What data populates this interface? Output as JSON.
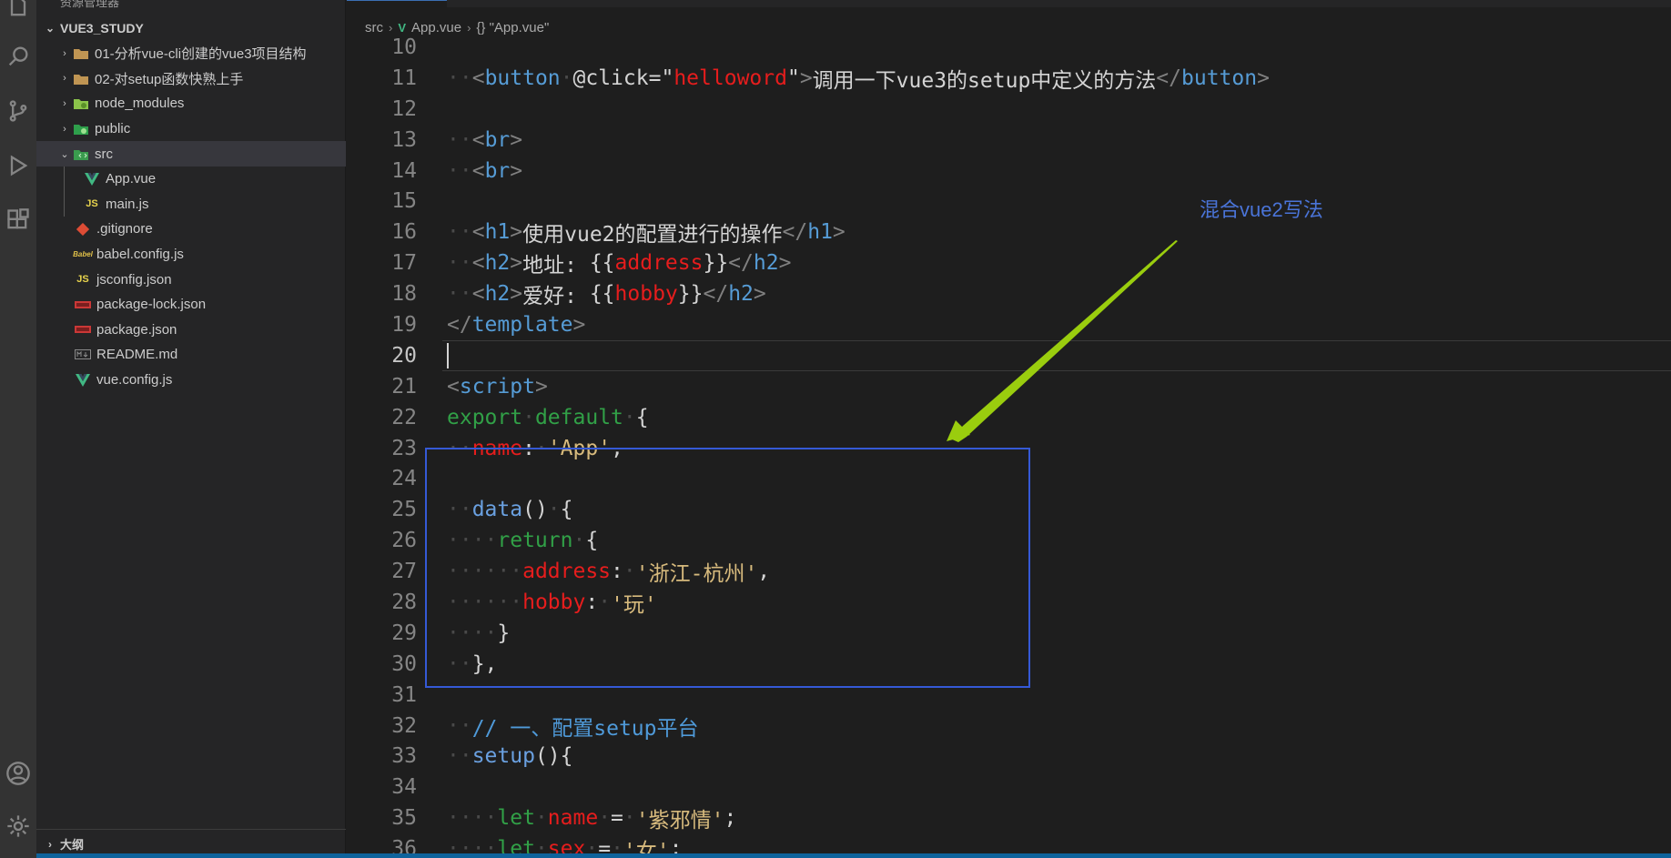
{
  "window": {
    "tab_label": "App.vue"
  },
  "sidebar": {
    "top_cut_label": "资源管理器",
    "root": "VUE3_STUDY",
    "items": [
      {
        "label": "01-分析vue-cli创建的vue3项目结构",
        "type": "folder",
        "expanded": false,
        "icon": "folder-icon"
      },
      {
        "label": "02-对setup函数快熟上手",
        "type": "folder",
        "expanded": false,
        "icon": "folder-icon"
      },
      {
        "label": "node_modules",
        "type": "folder",
        "expanded": false,
        "icon": "node-folder-icon"
      },
      {
        "label": "public",
        "type": "folder",
        "expanded": false,
        "icon": "public-folder-icon"
      },
      {
        "label": "src",
        "type": "folder",
        "expanded": true,
        "icon": "src-folder-icon"
      },
      {
        "label": "App.vue",
        "type": "file",
        "icon": "vue-icon"
      },
      {
        "label": "main.js",
        "type": "file",
        "icon": "js-icon"
      },
      {
        "label": ".gitignore",
        "type": "file",
        "icon": "git-icon"
      },
      {
        "label": "babel.config.js",
        "type": "file",
        "icon": "babel-icon"
      },
      {
        "label": "jsconfig.json",
        "type": "file",
        "icon": "js-icon"
      },
      {
        "label": "package-lock.json",
        "type": "file",
        "icon": "npm-icon"
      },
      {
        "label": "package.json",
        "type": "file",
        "icon": "npm-icon"
      },
      {
        "label": "README.md",
        "type": "file",
        "icon": "markdown-icon"
      },
      {
        "label": "vue.config.js",
        "type": "file",
        "icon": "vue-config-icon"
      }
    ],
    "outline": "大纲"
  },
  "breadcrumb": {
    "part1": "src",
    "part2": "App.vue",
    "part3": "{} \"App.vue\""
  },
  "editor": {
    "line_numbers": [
      "10",
      "11",
      "12",
      "13",
      "14",
      "15",
      "16",
      "17",
      "18",
      "19",
      "20",
      "21",
      "22",
      "23",
      "24",
      "25",
      "26",
      "27",
      "28",
      "29",
      "30",
      "31",
      "32",
      "33",
      "34",
      "35",
      "36"
    ],
    "current_line": "20",
    "l11_attr": "@click",
    "l11_val": "helloword",
    "l11_text": "调用一下vue3的setup中定义的方法",
    "l16_text": "使用vue2的配置进行的操作",
    "l17_label": "地址: ",
    "l17_var": "address",
    "l18_label": "爱好: ",
    "l18_var": "hobby",
    "l23_key": "name",
    "l23_val": "'App'",
    "l27_key": "address",
    "l27_val": "'浙江-杭州'",
    "l28_key": "hobby",
    "l28_val": "'玩'",
    "l32_comment": "// 一、配置setup平台",
    "l35_var": "name",
    "l35_val": "'紫邪情'",
    "l36_var": "sex",
    "l36_val": "'女'"
  },
  "annotation": {
    "text": "混合vue2写法",
    "box_color": "#3559d6",
    "arrow_color": "#9acd0e"
  }
}
